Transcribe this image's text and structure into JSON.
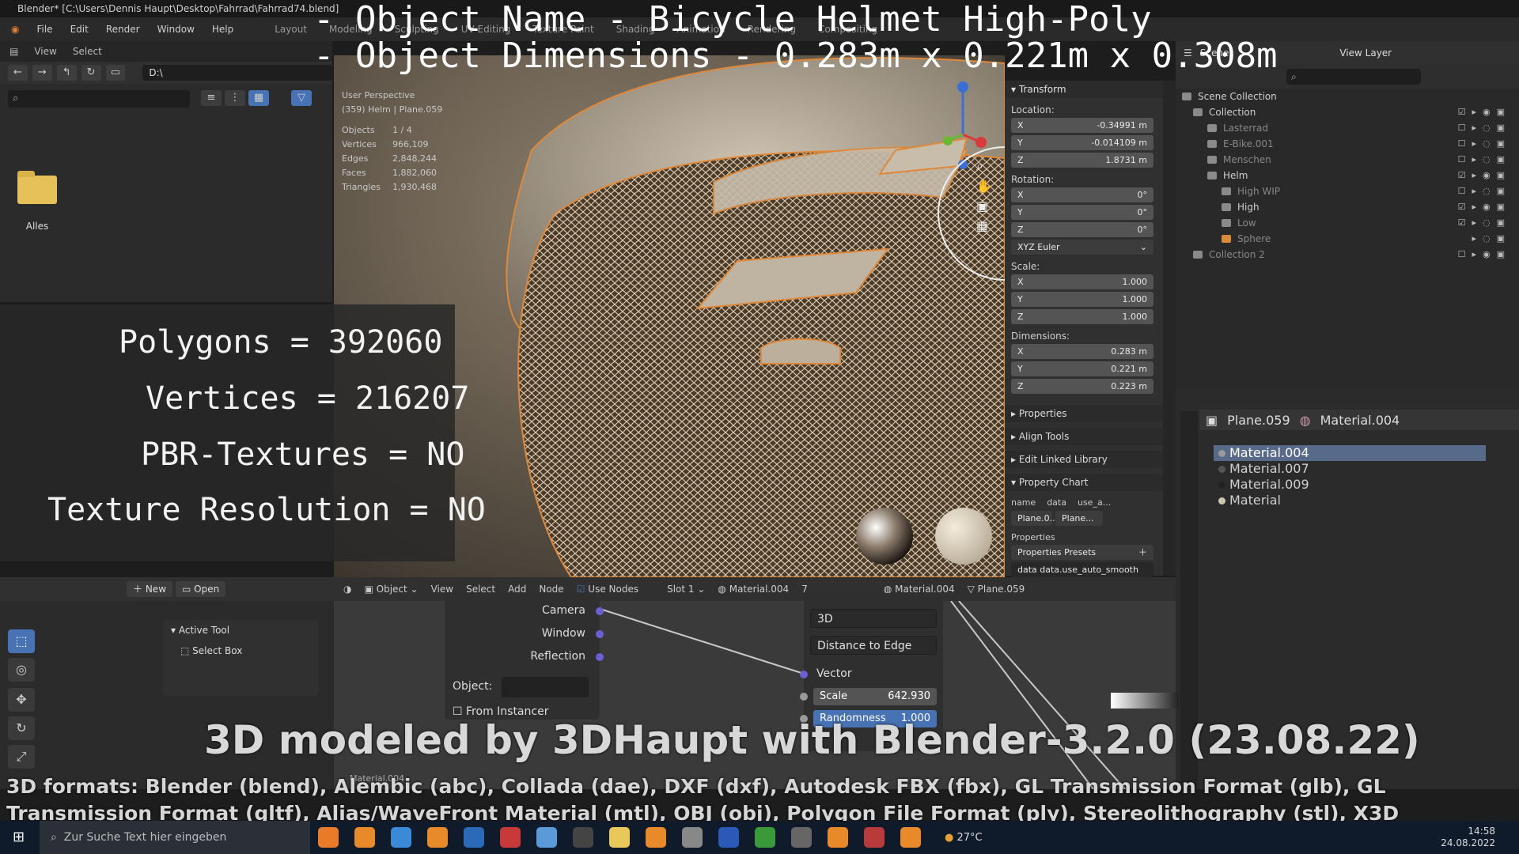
{
  "window": {
    "title": "Blender* [C:\\Users\\Dennis Haupt\\Desktop\\Fahrrad\\Fahrrad74.blend]",
    "menu": [
      "File",
      "Edit",
      "Render",
      "Window",
      "Help"
    ],
    "workspaces": [
      "Layout",
      "Modeling",
      "Sculpting",
      "UV Editing",
      "Texture Paint",
      "Shading",
      "Animation",
      "Rendering",
      "Compositing"
    ]
  },
  "overlay": {
    "title_line1": "- Object Name - Bicycle Helmet High-Poly",
    "title_line2": "- Object Dimensions -  0.283m x 0.221m x 0.308m",
    "stats": [
      "Polygons = 392060",
      "Vertices = 216207",
      "PBR-Textures = NO",
      "Texture Resolution = NO"
    ],
    "credit": "3D modeled by 3DHaupt with Blender-3.2.0 (23.08.22)",
    "formats": "3D formats: Blender (blend), Alembic (abc), Collada (dae), DXF (dxf), Autodesk FBX (fbx), GL Transmission Format (glb), GL Transmission Format (gltf), Alias/WaveFront Material (mtl), OBJ (obj), Polygon File Format (ply), Stereolithography (stl), X3D"
  },
  "file_browser": {
    "menu": [
      "View",
      "Select"
    ],
    "path": "D:\\",
    "folder_label": "Alles"
  },
  "viewport": {
    "perspective": "User Perspective",
    "collection_info": "(359) Helm | Plane.059",
    "info_rows": [
      {
        "key": "Objects",
        "value": "1 / 4"
      },
      {
        "key": "Vertices",
        "value": "966,109"
      },
      {
        "key": "Edges",
        "value": "2,848,244"
      },
      {
        "key": "Faces",
        "value": "1,882,060"
      },
      {
        "key": "Triangles",
        "value": "1,930,468"
      }
    ]
  },
  "transform_panel": {
    "header": "Transform",
    "location_label": "Location:",
    "location": [
      {
        "axis": "X",
        "value": "-0.34991 m"
      },
      {
        "axis": "Y",
        "value": "-0.014109 m"
      },
      {
        "axis": "Z",
        "value": "1.8731 m"
      }
    ],
    "rotation_label": "Rotation:",
    "rotation": [
      {
        "axis": "X",
        "value": "0°"
      },
      {
        "axis": "Y",
        "value": "0°"
      },
      {
        "axis": "Z",
        "value": "0°"
      }
    ],
    "rotation_mode": "XYZ Euler",
    "scale_label": "Scale:",
    "scale": [
      {
        "axis": "X",
        "value": "1.000"
      },
      {
        "axis": "Y",
        "value": "1.000"
      },
      {
        "axis": "Z",
        "value": "1.000"
      }
    ],
    "dimensions_label": "Dimensions:",
    "dimensions": [
      {
        "axis": "X",
        "value": "0.283 m"
      },
      {
        "axis": "Y",
        "value": "0.221 m"
      },
      {
        "axis": "Z",
        "value": "0.223 m"
      }
    ],
    "sections": [
      "Properties",
      "Align Tools",
      "Edit Linked Library",
      "Property Chart"
    ],
    "chart_cols": [
      "name",
      "data",
      "use_a..."
    ],
    "chart_row": [
      "Plane.0...",
      "Plane..."
    ],
    "properties_label": "Properties",
    "presets": "Properties Presets",
    "smooth_field": "data data.use_auto_smooth"
  },
  "outliner": {
    "scene": "Scene",
    "view_layer": "View Layer",
    "rows": [
      {
        "label": "Scene Collection",
        "indent": 0
      },
      {
        "label": "Collection",
        "indent": 1
      },
      {
        "label": "Lasterrad",
        "indent": 2
      },
      {
        "label": "E-Bike.001",
        "indent": 2
      },
      {
        "label": "Menschen",
        "indent": 2
      },
      {
        "label": "Helm",
        "indent": 2
      },
      {
        "label": "High WIP",
        "indent": 3
      },
      {
        "label": "High",
        "indent": 3
      },
      {
        "label": "Low",
        "indent": 3
      },
      {
        "label": "Sphere",
        "indent": 3
      },
      {
        "label": "Collection 2",
        "indent": 1
      }
    ]
  },
  "material_panel": {
    "object": "Plane.059",
    "material": "Material.004",
    "slots": [
      "Material.004",
      "Material.007",
      "Material.009",
      "Material"
    ]
  },
  "node_editor": {
    "header": {
      "mode": "Object",
      "menu": [
        "View",
        "Select",
        "Add",
        "Node"
      ],
      "use_nodes": "Use Nodes",
      "slot": "Slot 1",
      "material": "Material.004",
      "users": "7",
      "right_material": "Material.004",
      "right_object": "Plane.059"
    },
    "outputs": [
      "Camera",
      "Window",
      "Reflection"
    ],
    "object_label": "Object:",
    "from_instancer": "From Instancer",
    "voronoi": {
      "dimension": "3D",
      "feature": "Distance to Edge",
      "vector_label": "Vector",
      "scale_label": "Scale",
      "scale_value": "642.930",
      "randomness_label": "Randomness",
      "randomness_value": "1.000"
    },
    "material_label": "Material.004"
  },
  "tool_panel": {
    "new_label": "New",
    "open_label": "Open",
    "active_tool": "Active Tool",
    "select_box": "Select Box"
  },
  "taskbar": {
    "search_placeholder": "Zur Suche Text hier eingeben",
    "weather": "27°C",
    "time": "14:58",
    "date": "24.08.2022"
  }
}
